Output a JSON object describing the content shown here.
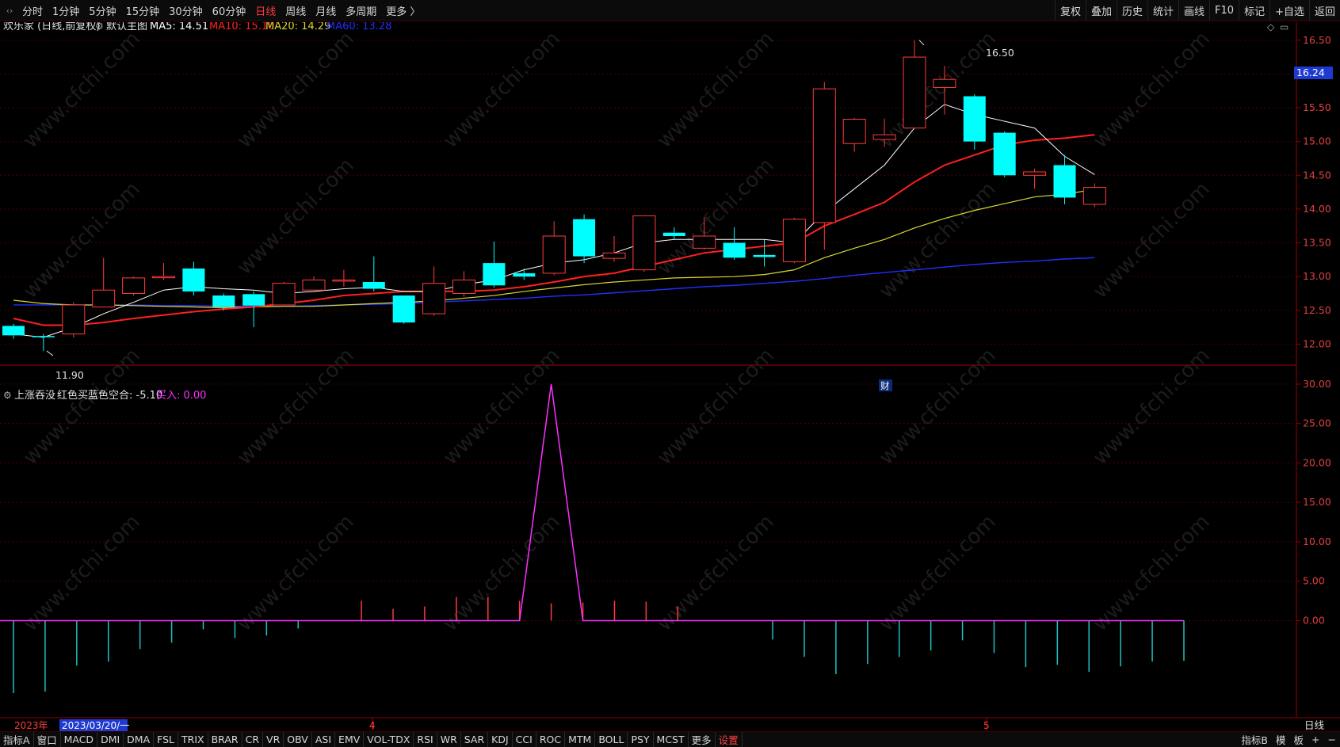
{
  "top_tabs": [
    "分时",
    "1分钟",
    "5分钟",
    "15分钟",
    "30分钟",
    "60分钟",
    "日线",
    "周线",
    "月线",
    "多周期",
    "更多 〉"
  ],
  "active_tab": "日线",
  "top_right": [
    "复权",
    "叠加",
    "历史",
    "统计",
    "画线",
    "F10",
    "标记",
    "+自选",
    "返回"
  ],
  "main_legend": {
    "title": "欢乐家 (日线,前复权)",
    "indicator": "默认主图",
    "ma5": "MA5: 14.51",
    "ma10": "MA10: 15.10",
    "ma20": "MA20: 14.29",
    "ma60": "MA60: 13.28"
  },
  "sub_legend": {
    "title": "上涨吞没",
    "sig": "红色买蓝色空合: -5.10",
    "buy": "买入: 0.00"
  },
  "price_labels": {
    "high": "16.50",
    "low": "11.90",
    "current": "16.24",
    "event": "财"
  },
  "main_axis": [
    "16.50",
    "16.00",
    "15.50",
    "15.00",
    "14.50",
    "14.00",
    "13.50",
    "13.00",
    "12.50",
    "12.00"
  ],
  "sub_axis": [
    "30.00",
    "25.00",
    "20.00",
    "15.00",
    "10.00",
    "5.00",
    "0.00"
  ],
  "date_axis": {
    "year": "2023年",
    "cursor_date": "2023/03/20/一",
    "month4": "4",
    "month5": "5",
    "right": "日线"
  },
  "bottom_tabs": [
    "指标A",
    "窗口",
    "MACD",
    "DMI",
    "DMA",
    "FSL",
    "TRIX",
    "BRAR",
    "CR",
    "VR",
    "OBV",
    "ASI",
    "EMV",
    "VOL-TDX",
    "RSI",
    "WR",
    "SAR",
    "KDJ",
    "CCI",
    "ROC",
    "MTM",
    "BOLL",
    "PSY",
    "MCST",
    "更多",
    "设置"
  ],
  "bottom_right": [
    "指标B",
    "模",
    "板",
    "+",
    "−"
  ],
  "watermark": "www.cfchi.com",
  "colors": {
    "up": "#ff3b3b",
    "down": "#00ffff",
    "ma5": "#ffffff",
    "ma10": "#ff2020",
    "ma20": "#d8d830",
    "ma60": "#2030ff",
    "signal": "#ff30ff",
    "grid": "#4a0000",
    "axis": "#9a0000"
  },
  "chart_data": {
    "type": "candlestick",
    "candles": [
      {
        "o": 12.27,
        "c": 12.13,
        "h": 12.3,
        "l": 12.08
      },
      {
        "o": 12.12,
        "c": 12.11,
        "h": 12.15,
        "l": 11.9
      },
      {
        "o": 12.15,
        "c": 12.58,
        "h": 12.62,
        "l": 12.1
      },
      {
        "o": 12.55,
        "c": 12.8,
        "h": 13.28,
        "l": 12.55
      },
      {
        "o": 12.75,
        "c": 12.98,
        "h": 13.0,
        "l": 12.72
      },
      {
        "o": 13.0,
        "c": 13.0,
        "h": 13.2,
        "l": 12.95
      },
      {
        "o": 13.12,
        "c": 12.78,
        "h": 13.22,
        "l": 12.72
      },
      {
        "o": 12.72,
        "c": 12.55,
        "h": 12.75,
        "l": 12.5
      },
      {
        "o": 12.74,
        "c": 12.57,
        "h": 12.78,
        "l": 12.25
      },
      {
        "o": 12.58,
        "c": 12.9,
        "h": 12.92,
        "l": 12.55
      },
      {
        "o": 12.8,
        "c": 12.95,
        "h": 13.0,
        "l": 12.8
      },
      {
        "o": 12.95,
        "c": 12.95,
        "h": 13.1,
        "l": 12.85
      },
      {
        "o": 12.92,
        "c": 12.82,
        "h": 13.3,
        "l": 12.78
      },
      {
        "o": 12.72,
        "c": 12.32,
        "h": 12.72,
        "l": 12.3
      },
      {
        "o": 12.45,
        "c": 12.9,
        "h": 13.15,
        "l": 12.42
      },
      {
        "o": 12.75,
        "c": 12.95,
        "h": 13.08,
        "l": 12.7
      },
      {
        "o": 13.2,
        "c": 12.87,
        "h": 13.52,
        "l": 12.84
      },
      {
        "o": 13.05,
        "c": 13.0,
        "h": 13.12,
        "l": 12.95
      },
      {
        "o": 13.05,
        "c": 13.6,
        "h": 13.82,
        "l": 13.02
      },
      {
        "o": 13.85,
        "c": 13.3,
        "h": 13.92,
        "l": 13.2
      },
      {
        "o": 13.27,
        "c": 13.35,
        "h": 13.6,
        "l": 13.22
      },
      {
        "o": 13.1,
        "c": 13.9,
        "h": 13.9,
        "l": 13.07
      },
      {
        "o": 13.65,
        "c": 13.6,
        "h": 13.73,
        "l": 13.55
      },
      {
        "o": 13.42,
        "c": 13.6,
        "h": 13.88,
        "l": 13.4
      },
      {
        "o": 13.5,
        "c": 13.28,
        "h": 13.73,
        "l": 13.25
      },
      {
        "o": 13.32,
        "c": 13.29,
        "h": 13.55,
        "l": 13.15
      },
      {
        "o": 13.22,
        "c": 13.85,
        "h": 13.87,
        "l": 13.2
      },
      {
        "o": 13.8,
        "c": 15.78,
        "h": 15.88,
        "l": 13.4
      },
      {
        "o": 14.97,
        "c": 15.33,
        "h": 15.35,
        "l": 14.85
      },
      {
        "o": 15.03,
        "c": 15.1,
        "h": 15.34,
        "l": 14.92
      },
      {
        "o": 15.2,
        "c": 16.25,
        "h": 16.5,
        "l": 15.2
      },
      {
        "o": 15.8,
        "c": 15.92,
        "h": 16.12,
        "l": 15.4
      },
      {
        "o": 15.67,
        "c": 15.0,
        "h": 15.7,
        "l": 14.88
      },
      {
        "o": 15.13,
        "c": 14.5,
        "h": 15.15,
        "l": 14.47
      },
      {
        "o": 14.5,
        "c": 14.55,
        "h": 14.6,
        "l": 14.3
      },
      {
        "o": 14.65,
        "c": 14.17,
        "h": 14.8,
        "l": 14.07
      },
      {
        "o": 14.07,
        "c": 14.32,
        "h": 14.38,
        "l": 14.03
      }
    ],
    "ma5": [
      12.15,
      12.1,
      12.25,
      12.45,
      12.62,
      12.8,
      12.85,
      12.82,
      12.8,
      12.75,
      12.78,
      12.82,
      12.84,
      12.78,
      12.78,
      12.88,
      12.95,
      13.1,
      13.2,
      13.25,
      13.35,
      13.5,
      13.55,
      13.55,
      13.55,
      13.55,
      13.5,
      13.95,
      14.3,
      14.65,
      15.2,
      15.55,
      15.4,
      15.3,
      15.2,
      14.78,
      14.51
    ],
    "ma10": [
      12.38,
      12.28,
      12.28,
      12.32,
      12.38,
      12.43,
      12.48,
      12.52,
      12.55,
      12.6,
      12.65,
      12.72,
      12.75,
      12.78,
      12.78,
      12.78,
      12.8,
      12.85,
      12.92,
      13.0,
      13.05,
      13.15,
      13.25,
      13.35,
      13.4,
      13.45,
      13.5,
      13.75,
      13.92,
      14.1,
      14.4,
      14.65,
      14.8,
      14.95,
      15.02,
      15.05,
      15.1
    ],
    "ma20": [
      12.65,
      12.6,
      12.58,
      12.58,
      12.57,
      12.56,
      12.55,
      12.54,
      12.55,
      12.56,
      12.56,
      12.58,
      12.6,
      12.62,
      12.64,
      12.68,
      12.72,
      12.78,
      12.83,
      12.88,
      12.92,
      12.95,
      12.98,
      12.99,
      13.0,
      13.03,
      13.1,
      13.28,
      13.42,
      13.55,
      13.72,
      13.86,
      13.98,
      14.08,
      14.18,
      14.22,
      14.29
    ],
    "ma60": [
      12.58,
      12.58,
      12.58,
      12.58,
      12.58,
      12.57,
      12.57,
      12.56,
      12.56,
      12.56,
      12.57,
      12.58,
      12.59,
      12.6,
      12.62,
      12.64,
      12.66,
      12.68,
      12.71,
      12.73,
      12.76,
      12.79,
      12.82,
      12.85,
      12.87,
      12.9,
      12.93,
      12.97,
      13.02,
      13.06,
      13.1,
      13.14,
      13.18,
      13.21,
      13.23,
      13.26,
      13.28
    ],
    "signal": [
      -9.2,
      -9.2,
      -6.0,
      -5.5,
      -3.8,
      -3.0,
      -1.2,
      -2.5,
      -2.0,
      -1.2,
      0,
      0,
      0,
      0,
      0,
      0,
      0,
      0,
      0,
      0,
      0,
      0,
      0,
      0,
      0,
      0,
      0,
      0,
      0,
      0,
      0,
      0,
      0,
      0,
      0,
      0,
      0
    ],
    "signal_line": [
      0,
      0,
      0,
      0,
      0,
      0,
      0,
      0,
      0,
      0,
      0,
      0,
      0,
      0,
      0,
      0,
      0,
      30,
      0,
      0,
      0,
      0,
      0,
      0,
      0,
      0,
      0,
      0,
      0,
      0,
      0,
      0,
      0,
      0,
      0,
      0,
      0,
      0
    ],
    "bars": [
      -9.2,
      -9.0,
      -5.7,
      -5.2,
      -3.6,
      -2.8,
      -1.1,
      -2.2,
      -1.9,
      -1.0,
      0,
      2.5,
      1.5,
      1.8,
      3.0,
      3.0,
      2.5,
      2.2,
      2.3,
      2.5,
      2.4,
      1.8,
      0,
      0,
      -2.4,
      -4.6,
      -6.8,
      -5.5,
      -4.6,
      -3.8,
      -2.5,
      -4.1,
      -5.9,
      -5.6,
      -6.5,
      -5.8,
      -5.2,
      -5.1
    ],
    "main_ylim": [
      11.7,
      16.72
    ],
    "sub_ylim": [
      -9.5,
      31.5
    ]
  }
}
